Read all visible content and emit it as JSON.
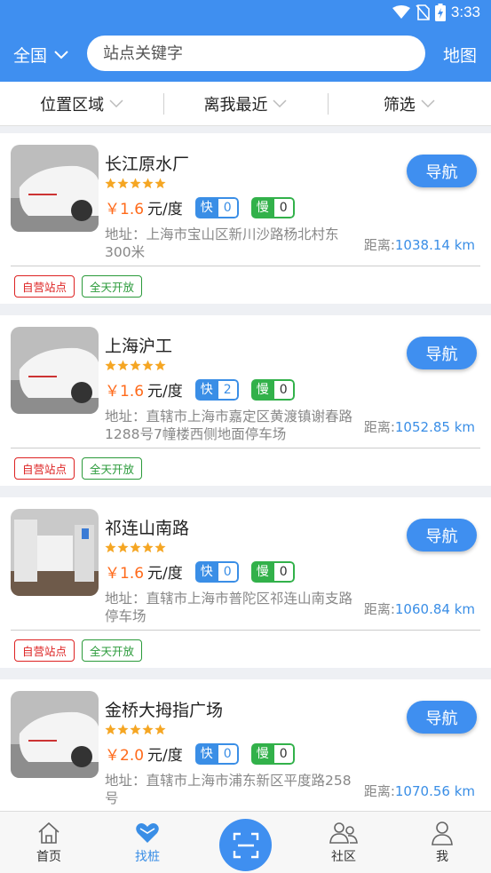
{
  "status_bar": {
    "time": "3:33"
  },
  "header": {
    "region": "全国",
    "search_placeholder": "站点关键字",
    "map_label": "地图"
  },
  "filters": [
    "位置区域",
    "离我最近",
    "筛选"
  ],
  "stations": [
    {
      "name": "长江原水厂",
      "rating": 5,
      "price": "￥1.6",
      "unit": "元/度",
      "fast_label": "快",
      "fast_count": "0",
      "slow_label": "慢",
      "slow_count": "0",
      "address": "地址：上海市宝山区新川沙路杨北村东300米",
      "distance_label": "距离:",
      "distance_value": "1038.14 km",
      "nav_label": "导航",
      "tags": [
        "自营站点",
        "全天开放"
      ],
      "image": "white-car-photo"
    },
    {
      "name": "上海沪工",
      "rating": 5,
      "price": "￥1.6",
      "unit": "元/度",
      "fast_label": "快",
      "fast_count": "2",
      "slow_label": "慢",
      "slow_count": "0",
      "address": "地址：直辖市上海市嘉定区黄渡镇谢春路1288号7幢楼西侧地面停车场",
      "distance_label": "距离:",
      "distance_value": "1052.85 km",
      "nav_label": "导航",
      "tags": [
        "自营站点",
        "全天开放"
      ],
      "image": "white-car-photo"
    },
    {
      "name": "祁连山南路",
      "rating": 5,
      "price": "￥1.6",
      "unit": "元/度",
      "fast_label": "快",
      "fast_count": "0",
      "slow_label": "慢",
      "slow_count": "0",
      "address": "地址：直辖市上海市普陀区祁连山南支路停车场",
      "distance_label": "距离:",
      "distance_value": "1060.84 km",
      "nav_label": "导航",
      "tags": [
        "自营站点",
        "全天开放"
      ],
      "image": "charging-station-photo"
    },
    {
      "name": "金桥大拇指广场",
      "rating": 5,
      "price": "￥2.0",
      "unit": "元/度",
      "fast_label": "快",
      "fast_count": "0",
      "slow_label": "慢",
      "slow_count": "0",
      "address": "地址：直辖市上海市浦东新区平度路258号",
      "distance_label": "距离:",
      "distance_value": "1070.56 km",
      "nav_label": "导航",
      "tags": [],
      "image": "white-car-photo"
    }
  ],
  "bottom_nav": [
    {
      "label": "首页",
      "icon": "home-icon",
      "active": false
    },
    {
      "label": "找桩",
      "icon": "heart-icon",
      "active": true
    },
    {
      "label": "",
      "icon": "scan-icon",
      "active": false
    },
    {
      "label": "社区",
      "icon": "community-icon",
      "active": false
    },
    {
      "label": "我",
      "icon": "profile-icon",
      "active": false
    }
  ],
  "colors": {
    "primary": "#3f8ff0",
    "price": "#ff6a1a",
    "fast": "#3a8ee6",
    "slow": "#32b14a",
    "tag_red": "#dd2222",
    "tag_green": "#2a9a3a",
    "star": "#f5a623"
  }
}
